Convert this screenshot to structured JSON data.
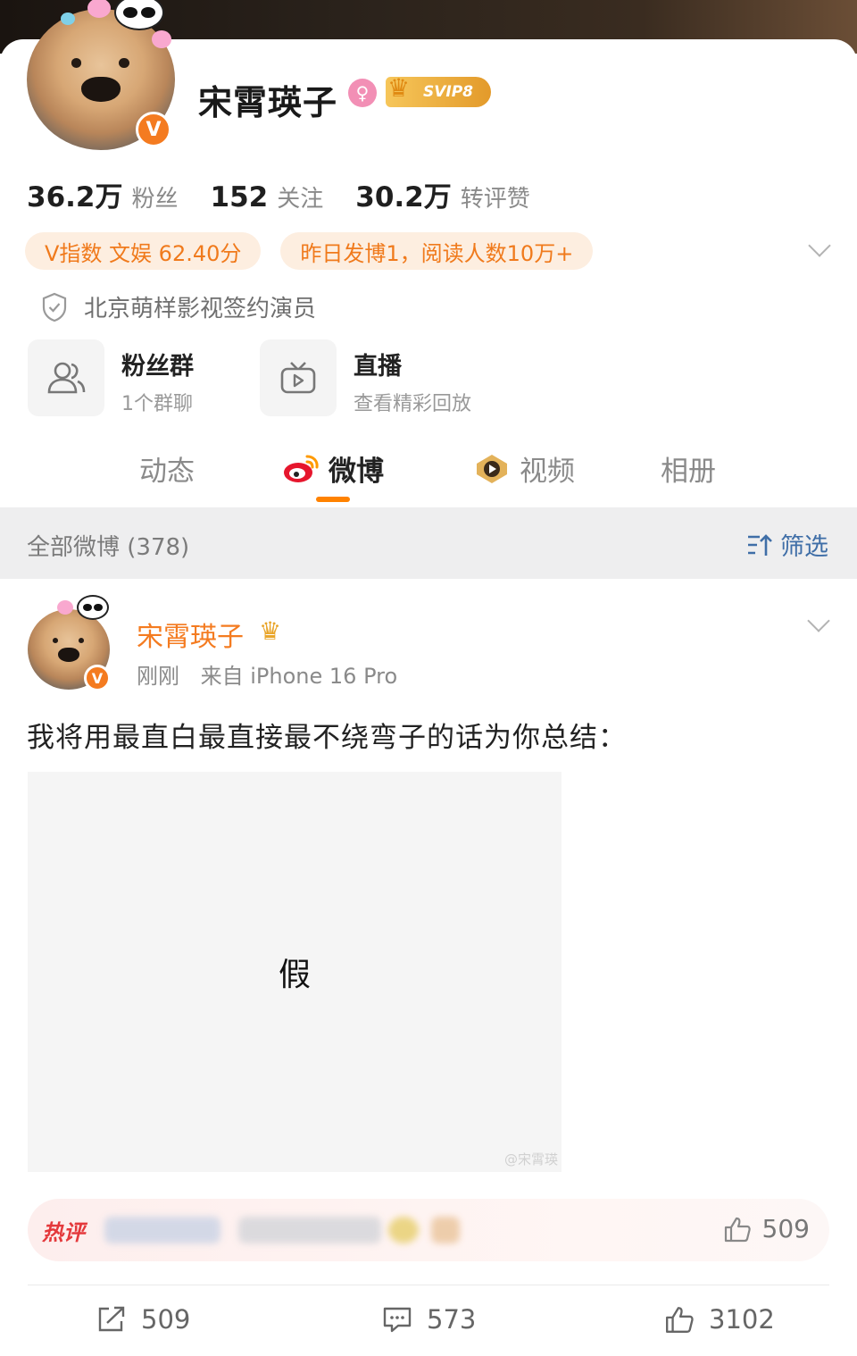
{
  "profile": {
    "name": "宋霄瑛子",
    "gender_symbol": "♀",
    "svip_label": "SVIP8",
    "verified_mark": "V"
  },
  "stats": [
    {
      "number": "36.2万",
      "label": "粉丝"
    },
    {
      "number": "152",
      "label": "关注"
    },
    {
      "number": "30.2万",
      "label": "转评赞"
    }
  ],
  "chips": [
    {
      "label": "V指数 文娱 62.40分"
    },
    {
      "label": "昨日发博1，阅读人数10万+"
    }
  ],
  "certification": "北京萌样影视签约演员",
  "tiles": [
    {
      "title": "粉丝群",
      "subtitle": "1个群聊",
      "icon": "fans-group-icon"
    },
    {
      "title": "直播",
      "subtitle": "查看精彩回放",
      "icon": "live-tv-icon"
    }
  ],
  "tabs": [
    {
      "label": "动态"
    },
    {
      "label": "微博",
      "active": true
    },
    {
      "label": "视频"
    },
    {
      "label": "相册"
    }
  ],
  "filter_bar": {
    "left": "全部微博 (378)",
    "right": "筛选"
  },
  "post": {
    "author": "宋霄瑛子",
    "time": "刚刚",
    "source": "来自 iPhone 16 Pro",
    "text": "我将用最直白最直接最不绕弯子的话为你总结：",
    "image_text": "假",
    "watermark": "@宋霄瑛",
    "hot_comment": {
      "tag": "热评",
      "likes": "509"
    },
    "actions": {
      "reposts": "509",
      "comments": "573",
      "likes": "3102"
    }
  },
  "colors": {
    "accent_orange": "#f47b20",
    "tab_underline": "#ff8200",
    "filter_blue": "#3f6ea7",
    "hot_red": "#e4393c"
  }
}
